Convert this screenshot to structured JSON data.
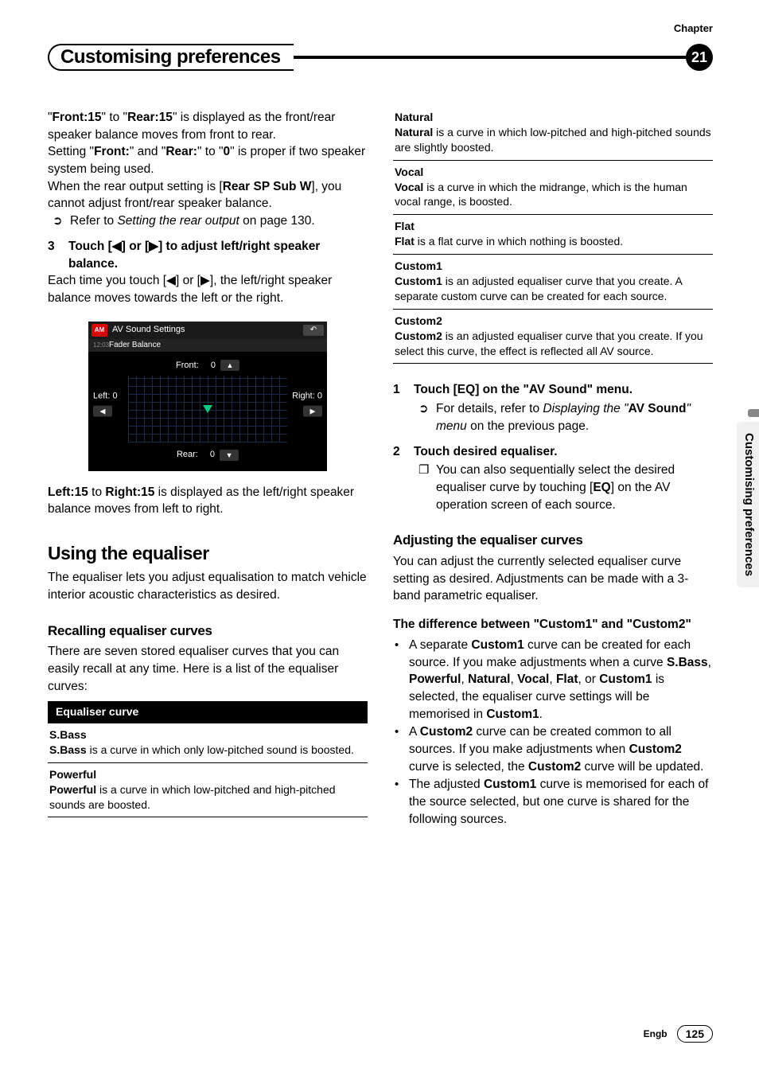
{
  "chapter_label": "Chapter",
  "chapter_num": "21",
  "title": "Customising preferences",
  "side_tab": "Customising preferences",
  "footer_lang": "Engb",
  "footer_page": "125",
  "left": {
    "p1": {
      "front15": "Front:15",
      "to": "\" to \"",
      "rear15": "Rear:15",
      "tail": "\" is displayed as the front/rear speaker balance moves from front to rear."
    },
    "p2": {
      "a": "Setting \"",
      "front": "Front:",
      "b": "\" and \"",
      "rear": "Rear:",
      "c": "\" to \"",
      "zero": "0",
      "d": "\" is proper if two speaker system being used."
    },
    "p3": {
      "a": "When the rear output setting is [",
      "rearsp": "Rear SP Sub W",
      "b": "], you cannot adjust front/rear speaker balance."
    },
    "refer": {
      "a": "Refer to ",
      "i": "Setting the rear output",
      "b": " on page 130."
    },
    "step3": {
      "num": "3",
      "head": "Touch [◀] or [▶] to adjust left/right speaker balance.",
      "body": "Each time you touch [◀] or [▶], the left/right speaker balance moves towards the left or the right."
    },
    "screenshot": {
      "title": "AV Sound Settings",
      "sub": "Fader Balance",
      "time": "12:03",
      "front": "Front:",
      "front_v": "0",
      "rear": "Rear:",
      "rear_v": "0",
      "left": "Left:",
      "left_v": "0",
      "right": "Right:",
      "right_v": "0"
    },
    "p4": {
      "left15": "Left:15",
      "to": " to ",
      "right15": "Right:15",
      "tail": " is displayed as the left/right speaker balance moves from left to right."
    },
    "h2": "Using the equaliser",
    "p5": "The equaliser lets you adjust equalisation to match vehicle interior acoustic characteristics as desired.",
    "h3": "Recalling equaliser curves",
    "p6": "There are seven stored equaliser curves that you can easily recall at any time. Here is a list of the equaliser curves:",
    "table_head": "Equaliser curve",
    "rows": [
      {
        "name": "S.Bass",
        "bold": "S.Bass",
        "desc": " is a curve in which only low-pitched sound is boosted."
      },
      {
        "name": "Powerful",
        "bold": "Powerful",
        "desc": " is a curve in which low-pitched and high-pitched sounds are boosted."
      }
    ]
  },
  "right": {
    "rows": [
      {
        "name": "Natural",
        "bold": "Natural",
        "desc": " is a curve in which low-pitched and high-pitched sounds are slightly boosted."
      },
      {
        "name": "Vocal",
        "bold": "Vocal",
        "desc": " is a curve in which the midrange, which is the human vocal range, is boosted."
      },
      {
        "name": "Flat",
        "bold": "Flat",
        "desc": " is a flat curve in which nothing is boosted."
      },
      {
        "name": "Custom1",
        "bold": "Custom1",
        "desc": " is an adjusted equaliser curve that you create. A separate custom curve can be created for each source."
      },
      {
        "name": "Custom2",
        "bold": "Custom2",
        "desc": " is an adjusted equaliser curve that you create. If you select this curve, the effect is reflected all AV source."
      }
    ],
    "step1": {
      "num": "1",
      "head": "Touch [EQ] on the \"AV Sound\" menu.",
      "sub_a": "For details, refer to ",
      "sub_i1": "Displaying the \"",
      "sub_b1": "AV Sound",
      "sub_i2": "\" menu",
      "sub_b": " on the previous page."
    },
    "step2": {
      "num": "2",
      "head": "Touch desired equaliser.",
      "sub_a": "You can also sequentially select the desired equaliser curve by touching [",
      "eq": "EQ",
      "sub_b": "] on the AV operation screen of each source."
    },
    "h3": "Adjusting the equaliser curves",
    "p1": "You can adjust the currently selected equaliser curve setting as desired. Adjustments can be made with a 3-band parametric equaliser.",
    "h4_a": "The difference between \"",
    "h4_c1": "Custom1",
    "h4_b": "\" and \"",
    "h4_c2": "Custom2",
    "h4_c": "\"",
    "bul1_a": "A separate ",
    "bul1_b": "Custom1",
    "bul1_c": " curve can be created for each source. If you make adjustments when a curve ",
    "bul1_d": "S.Bass",
    "bul1_e": ", ",
    "bul1_f": "Powerful",
    "bul1_g": ", ",
    "bul1_h": "Natural",
    "bul1_i": ", ",
    "bul1_j": "Vocal",
    "bul1_k": ", ",
    "bul1_l": "Flat",
    "bul1_m": ", or ",
    "bul1_n": "Custom1",
    "bul1_o": " is selected, the equaliser curve settings will be memorised in ",
    "bul1_p": "Custom1",
    "bul1_q": ".",
    "bul2_a": "A ",
    "bul2_b": "Custom2",
    "bul2_c": " curve can be created common to all sources. If you make adjustments when ",
    "bul2_d": "Custom2",
    "bul2_e": " curve is selected, the ",
    "bul2_f": "Custom2",
    "bul2_g": " curve will be updated.",
    "bul3_a": "The adjusted ",
    "bul3_b": "Custom1",
    "bul3_c": " curve is memorised for each of the source selected, but one curve is shared for the following sources."
  }
}
